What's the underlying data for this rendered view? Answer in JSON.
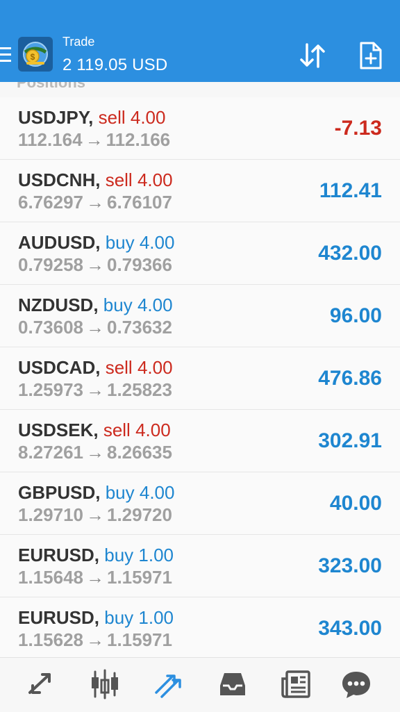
{
  "header": {
    "title": "Trade",
    "balance": "2 119.05 USD"
  },
  "section": {
    "title": "Positions"
  },
  "positions": [
    {
      "symbol": "USDJPY",
      "type": "sell",
      "volume": "4.00",
      "open": "112.164",
      "current": "112.166",
      "profit": "-7.13"
    },
    {
      "symbol": "USDCNH",
      "type": "sell",
      "volume": "4.00",
      "open": "6.76297",
      "current": "6.76107",
      "profit": "112.41"
    },
    {
      "symbol": "AUDUSD",
      "type": "buy",
      "volume": "4.00",
      "open": "0.79258",
      "current": "0.79366",
      "profit": "432.00"
    },
    {
      "symbol": "NZDUSD",
      "type": "buy",
      "volume": "4.00",
      "open": "0.73608",
      "current": "0.73632",
      "profit": "96.00"
    },
    {
      "symbol": "USDCAD",
      "type": "sell",
      "volume": "4.00",
      "open": "1.25973",
      "current": "1.25823",
      "profit": "476.86"
    },
    {
      "symbol": "USDSEK",
      "type": "sell",
      "volume": "4.00",
      "open": "8.27261",
      "current": "8.26635",
      "profit": "302.91"
    },
    {
      "symbol": "GBPUSD",
      "type": "buy",
      "volume": "4.00",
      "open": "1.29710",
      "current": "1.29720",
      "profit": "40.00"
    },
    {
      "symbol": "EURUSD",
      "type": "buy",
      "volume": "1.00",
      "open": "1.15648",
      "current": "1.15971",
      "profit": "323.00"
    },
    {
      "symbol": "EURUSD",
      "type": "buy",
      "volume": "1.00",
      "open": "1.15628",
      "current": "1.15971",
      "profit": "343.00"
    }
  ],
  "nav": [
    {
      "name": "quotes-icon",
      "active": false
    },
    {
      "name": "charts-icon",
      "active": false
    },
    {
      "name": "trade-icon",
      "active": true
    },
    {
      "name": "history-icon",
      "active": false
    },
    {
      "name": "news-icon",
      "active": false
    },
    {
      "name": "chat-icon",
      "active": false
    }
  ],
  "colors": {
    "accent": "#2c8fe0",
    "sell": "#cc2a1e",
    "buy": "#1e86d0",
    "muted": "#a0a0a0"
  }
}
